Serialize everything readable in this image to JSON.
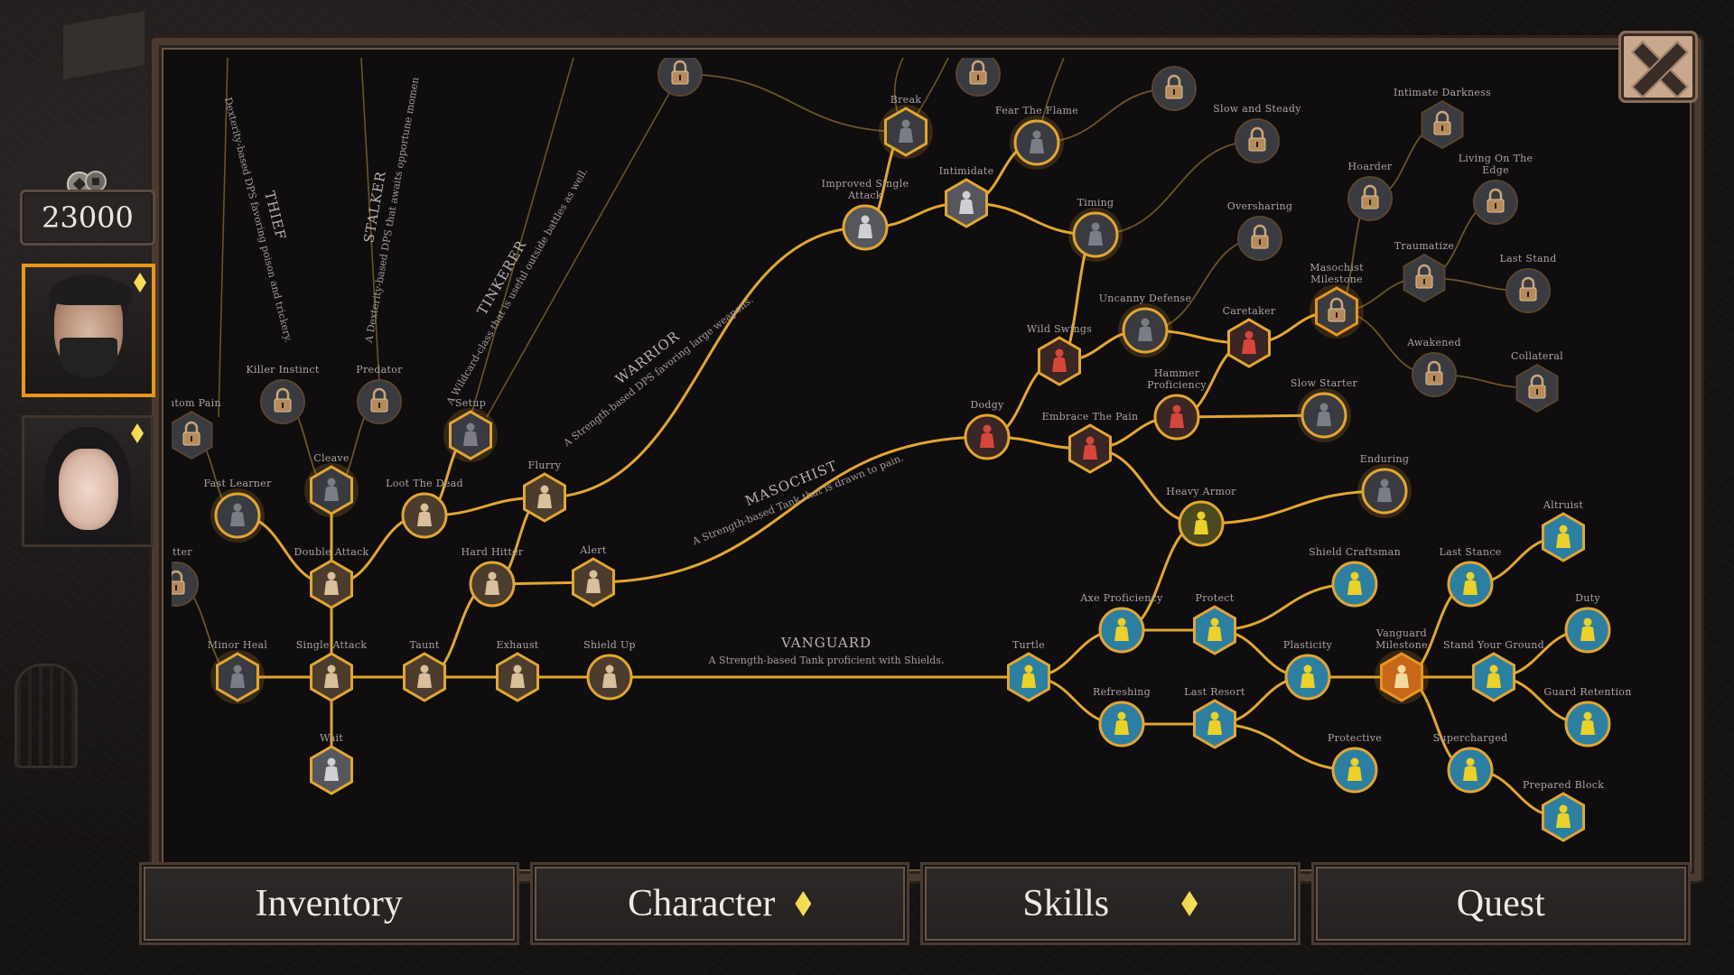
{
  "currency": {
    "amount": "23000",
    "icon": "coins-icon"
  },
  "party": [
    {
      "name": "bearded-man",
      "selected": true,
      "has_upgrade": true
    },
    {
      "name": "dark-haired-woman",
      "selected": false,
      "has_upgrade": true
    }
  ],
  "close_label": "close",
  "tabs": [
    {
      "label": "Inventory",
      "notify": false
    },
    {
      "label": "Character",
      "notify": true
    },
    {
      "label": "Skills",
      "notify": true
    },
    {
      "label": "Quest",
      "notify": false
    }
  ],
  "colors": {
    "gold": "#e2a630",
    "dim_line": "#6b5525",
    "milestone": "#e8961c",
    "red": "#d6463a",
    "blue": "#2c7fa1",
    "yellow": "#ebd12a"
  },
  "classes": [
    {
      "id": "thief",
      "title": "THIEF",
      "desc": "Dexterity-based DPS favoring poison and trickery."
    },
    {
      "id": "stalker",
      "title": "STALKER",
      "desc": "A Dexterity-based DPS that awaits opportune momen"
    },
    {
      "id": "tinkerer",
      "title": "TINKERER",
      "desc": "A Wildcard-class that is useful outside battles as well."
    },
    {
      "id": "warrior",
      "title": "WARRIOR",
      "desc": "A Strength-based DPS favoring large weapons."
    },
    {
      "id": "masochist",
      "title": "MASOCHIST",
      "desc": "A Strength-based Tank that is drawn to pain."
    },
    {
      "id": "vanguard",
      "title": "VANGUARD",
      "desc": "A Strength-based Tank proficient with Shields."
    }
  ],
  "skills": [
    {
      "id": "phantom-pain",
      "label": "antom Pain",
      "shape": "hex",
      "state": "locked",
      "theme": "grey"
    },
    {
      "id": "killer-instinct",
      "label": "Killer Instinct",
      "shape": "circle",
      "state": "locked",
      "theme": "grey"
    },
    {
      "id": "predator",
      "label": "Predator",
      "shape": "circle",
      "state": "locked",
      "theme": "grey"
    },
    {
      "id": "setup",
      "label": "Setup",
      "shape": "hex",
      "state": "available",
      "theme": "grey"
    },
    {
      "id": "fast-learner",
      "label": "Fast Learner",
      "shape": "circle",
      "state": "available",
      "theme": "grey"
    },
    {
      "id": "cleave",
      "label": "Cleave",
      "shape": "hex",
      "state": "available",
      "theme": "grey"
    },
    {
      "id": "loot-the-dead",
      "label": "Loot The Dead",
      "shape": "circle",
      "state": "learned",
      "theme": "tan"
    },
    {
      "id": "flurry",
      "label": "Flurry",
      "shape": "hex",
      "state": "learned",
      "theme": "tan"
    },
    {
      "id": "hitter",
      "label": "Hitter",
      "shape": "circle",
      "state": "locked",
      "theme": "grey"
    },
    {
      "id": "double-attack",
      "label": "Double Attack",
      "shape": "hex",
      "state": "learned",
      "theme": "tan"
    },
    {
      "id": "hard-hitter",
      "label": "Hard Hitter",
      "shape": "circle",
      "state": "learned",
      "theme": "tan"
    },
    {
      "id": "alert",
      "label": "Alert",
      "shape": "hex",
      "state": "learned",
      "theme": "tan"
    },
    {
      "id": "minor-heal",
      "label": "Minor Heal",
      "shape": "hex",
      "state": "available",
      "theme": "grey"
    },
    {
      "id": "single-attack",
      "label": "Single Attack",
      "shape": "hex",
      "state": "learned",
      "theme": "tan"
    },
    {
      "id": "taunt",
      "label": "Taunt",
      "shape": "hex",
      "state": "learned",
      "theme": "tan"
    },
    {
      "id": "exhaust",
      "label": "Exhaust",
      "shape": "hex",
      "state": "learned",
      "theme": "tan"
    },
    {
      "id": "shield-up",
      "label": "Shield Up",
      "shape": "circle",
      "state": "learned",
      "theme": "tan"
    },
    {
      "id": "wait",
      "label": "Wait",
      "shape": "hex",
      "state": "learned",
      "theme": "silver"
    },
    {
      "id": "top-lock-1",
      "label": "",
      "shape": "circle",
      "state": "locked",
      "theme": "grey"
    },
    {
      "id": "top-lock-2",
      "label": "",
      "shape": "circle",
      "state": "locked",
      "theme": "grey"
    },
    {
      "id": "top-lock-3",
      "label": "",
      "shape": "circle",
      "state": "locked",
      "theme": "grey"
    },
    {
      "id": "break",
      "label": "Break",
      "shape": "hex",
      "state": "available",
      "theme": "grey"
    },
    {
      "id": "fear-the-flame",
      "label": "Fear The Flame",
      "shape": "circle",
      "state": "available",
      "theme": "grey"
    },
    {
      "id": "improved-single-attack",
      "label": "Improved Single Attack",
      "shape": "circle",
      "state": "learned",
      "theme": "silver"
    },
    {
      "id": "intimidate",
      "label": "Intimidate",
      "shape": "hex",
      "state": "learned",
      "theme": "silver"
    },
    {
      "id": "timing",
      "label": "Timing",
      "shape": "circle",
      "state": "available",
      "theme": "grey"
    },
    {
      "id": "slow-and-steady",
      "label": "Slow and Steady",
      "shape": "circle",
      "state": "locked",
      "theme": "grey"
    },
    {
      "id": "oversharing",
      "label": "Oversharing",
      "shape": "circle",
      "state": "locked",
      "theme": "grey"
    },
    {
      "id": "intimate-darkness",
      "label": "Intimate Darkness",
      "shape": "hex",
      "state": "locked",
      "theme": "grey"
    },
    {
      "id": "hoarder",
      "label": "Hoarder",
      "shape": "circle",
      "state": "locked",
      "theme": "grey"
    },
    {
      "id": "living-on-the-edge",
      "label": "Living On The Edge",
      "shape": "circle",
      "state": "locked",
      "theme": "grey"
    },
    {
      "id": "traumatize",
      "label": "Traumatize",
      "shape": "hex",
      "state": "locked",
      "theme": "grey"
    },
    {
      "id": "last-stand",
      "label": "Last Stand",
      "shape": "circle",
      "state": "locked",
      "theme": "grey"
    },
    {
      "id": "masochist-milestone",
      "label": "Masochist Milestone",
      "shape": "hex",
      "state": "milestone",
      "theme": "grey"
    },
    {
      "id": "awakened",
      "label": "Awakened",
      "shape": "circle",
      "state": "locked",
      "theme": "grey"
    },
    {
      "id": "collateral",
      "label": "Collateral",
      "shape": "hex",
      "state": "locked",
      "theme": "grey"
    },
    {
      "id": "uncanny-defense",
      "label": "Uncanny Defense",
      "shape": "circle",
      "state": "available",
      "theme": "grey"
    },
    {
      "id": "wild-swings",
      "label": "Wild Swings",
      "shape": "hex",
      "state": "learned",
      "theme": "red"
    },
    {
      "id": "caretaker",
      "label": "Caretaker",
      "shape": "hex",
      "state": "learned",
      "theme": "red"
    },
    {
      "id": "hammer-proficiency",
      "label": "Hammer Proficiency",
      "shape": "circle",
      "state": "learned",
      "theme": "red"
    },
    {
      "id": "slow-starter",
      "label": "Slow Starter",
      "shape": "circle",
      "state": "available",
      "theme": "grey"
    },
    {
      "id": "dodgy",
      "label": "Dodgy",
      "shape": "circle",
      "state": "learned",
      "theme": "red"
    },
    {
      "id": "embrace-the-pain",
      "label": "Embrace The Pain",
      "shape": "hex",
      "state": "learned",
      "theme": "red"
    },
    {
      "id": "enduring",
      "label": "Enduring",
      "shape": "circle",
      "state": "available",
      "theme": "grey"
    },
    {
      "id": "heavy-armor",
      "label": "Heavy Armor",
      "shape": "circle",
      "state": "learned",
      "theme": "yellow"
    },
    {
      "id": "shield-craftsman",
      "label": "Shield Craftsman",
      "shape": "circle",
      "state": "learned",
      "theme": "blue"
    },
    {
      "id": "last-stance",
      "label": "Last Stance",
      "shape": "circle",
      "state": "learned",
      "theme": "blue"
    },
    {
      "id": "altruist",
      "label": "Altruist",
      "shape": "hex",
      "state": "learned",
      "theme": "blue"
    },
    {
      "id": "axe-proficiency",
      "label": "Axe Proficiency",
      "shape": "circle",
      "state": "learned",
      "theme": "blue"
    },
    {
      "id": "protect",
      "label": "Protect",
      "shape": "hex",
      "state": "learned",
      "theme": "blue"
    },
    {
      "id": "duty",
      "label": "Duty",
      "shape": "circle",
      "state": "learned",
      "theme": "blue"
    },
    {
      "id": "turtle",
      "label": "Turtle",
      "shape": "hex",
      "state": "learned",
      "theme": "blue"
    },
    {
      "id": "plasticity",
      "label": "Plasticity",
      "shape": "circle",
      "state": "learned",
      "theme": "blue"
    },
    {
      "id": "vanguard-milestone",
      "label": "Vanguard Milestone",
      "shape": "hex",
      "state": "milestone",
      "theme": "orange"
    },
    {
      "id": "stand-your-ground",
      "label": "Stand Your Ground",
      "shape": "hex",
      "state": "learned",
      "theme": "blue"
    },
    {
      "id": "refreshing",
      "label": "Refreshing",
      "shape": "circle",
      "state": "learned",
      "theme": "blue"
    },
    {
      "id": "last-resort",
      "label": "Last Resort",
      "shape": "hex",
      "state": "learned",
      "theme": "blue"
    },
    {
      "id": "guard-retention",
      "label": "Guard Retention",
      "shape": "circle",
      "state": "learned",
      "theme": "blue"
    },
    {
      "id": "protective",
      "label": "Protective",
      "shape": "circle",
      "state": "learned",
      "theme": "blue"
    },
    {
      "id": "supercharged",
      "label": "Supercharged",
      "shape": "circle",
      "state": "learned",
      "theme": "blue"
    },
    {
      "id": "prepared-block",
      "label": "Prepared Block",
      "shape": "hex",
      "state": "learned",
      "theme": "blue"
    }
  ]
}
